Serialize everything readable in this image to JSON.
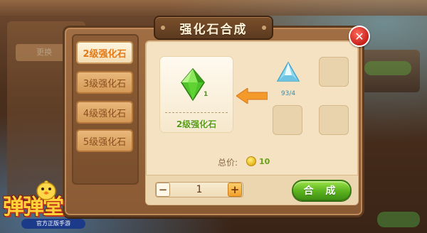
{
  "dialog": {
    "title": "强化石合成",
    "close_icon": "close-icon"
  },
  "tabs": [
    {
      "label": "2级强化石",
      "active": true
    },
    {
      "label": "3级强化石",
      "active": false
    },
    {
      "label": "4级强化石",
      "active": false
    },
    {
      "label": "5级强化石",
      "active": false
    }
  ],
  "result": {
    "name": "2级强化石",
    "count": "1",
    "icon": "green-gem-icon"
  },
  "ingredients": [
    {
      "icon": "blue-gem-icon",
      "count": "93/4"
    },
    {
      "icon": "",
      "count": ""
    },
    {
      "icon": "",
      "count": ""
    },
    {
      "icon": "",
      "count": ""
    }
  ],
  "cost": {
    "label": "总价:",
    "value": "10",
    "icon": "gold-coin-icon"
  },
  "quantity": {
    "minus": "−",
    "value": "1",
    "plus": "+"
  },
  "combine_button": "合 成",
  "background": {
    "left_tag": "更换"
  },
  "logo": {
    "title": "弹弹堂",
    "subtitle": "官方正版手游"
  },
  "colors": {
    "accent_green": "#5bb21e",
    "tab_active_text": "#e27a1a",
    "close_red": "#c8201a",
    "panel_bg": "#f4e2c2"
  }
}
